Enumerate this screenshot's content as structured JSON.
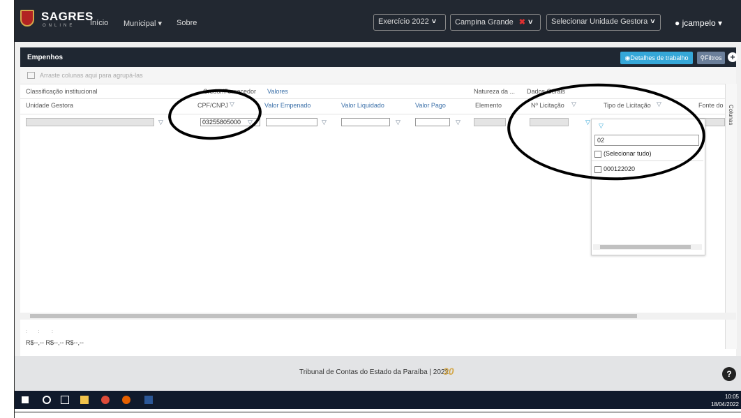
{
  "navbar": {
    "logo": "SAGRES",
    "logo_sub": "ONLINE",
    "links": [
      "Início",
      "Municipal ▾",
      "Sobre"
    ],
    "exercicio": "Exercício 2022",
    "municipio": "Campina Grande",
    "unidade": "Selecionar Unidade Gestora",
    "user": "jcampelo ▾"
  },
  "panel": {
    "title": "Empenhos",
    "detail_button": "Detalhes de trabalho",
    "filter_button": "Filtros",
    "group_hint": "Arraste colunas aqui para agrupá-las"
  },
  "bands": {
    "classificacao": "Classificação institucional",
    "credor": "Credor/Fornecedor",
    "valores": "Valores",
    "natureza": "Natureza da ...",
    "dados": "Dados Gerais"
  },
  "columns": {
    "unidade": "Unidade Gestora",
    "cpf": "CPF/CNPJ",
    "empenhado": "Valor Empenado",
    "liquidado": "Valor Liquidado",
    "pago": "Valor Pago",
    "elemento": "Elemento",
    "licitacao": "Nº Licitação",
    "tipo": "Tipo de Licitação",
    "fonte": "Fonte do Rec"
  },
  "filters": {
    "cpf_value": "03255805000"
  },
  "side_label": "Colunas",
  "dropdown": {
    "search_value": "02",
    "select_all": "(Selecionar tudo)",
    "items": [
      "000122020"
    ]
  },
  "totals": {
    "values": [
      "R$--,--",
      "R$--,--",
      "R$--,--"
    ]
  },
  "footer": {
    "text": "Tribunal de Contas do Estado da Paraíba | 2022",
    "help": "?"
  },
  "taskbar": {
    "time": "10:05",
    "date": "18/04/2022"
  },
  "colors": {
    "navbar": "#222831",
    "panel_header": "#1f2732",
    "detail_button": "#35a7d8",
    "header_blue": "#3a6fa8"
  }
}
